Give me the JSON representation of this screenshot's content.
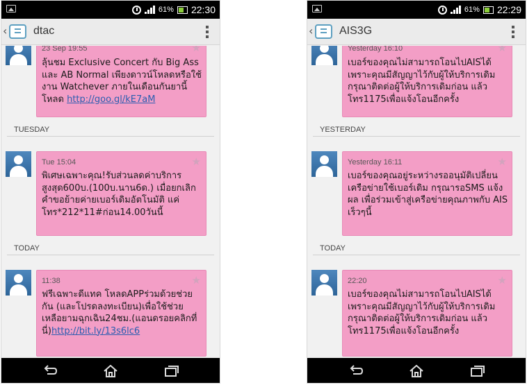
{
  "statusbar": {
    "battery": "61%",
    "left_time": "22:30",
    "right_time": "22:29"
  },
  "left": {
    "title": "dtac",
    "messages": [
      {
        "time": "23 Sep 19:55",
        "text": "ลุ้นชม Exclusive Concert กับ Big Ass และ AB Normal เพียงดาวน์โหลดหรือใช้งาน Watchever ภายในเดือนกันยานี้ โหลด ",
        "link": "http://goo.gl/kE7aM"
      },
      {
        "section": "TUESDAY",
        "time": "Tue 15:04",
        "text": "พิเศษเฉพาะคุณ!รับส่วนลดค่าบริการสูงสุด600บ.(100บ.นาน6ด.) เมื่อยกเลิกคำขอย้ายค่ายเบอร์เดิมอัตโนมัติ แค่โทร*212*11#ก่อน14.00วันนี้",
        "link": ""
      },
      {
        "section": "TODAY",
        "time": "11:38",
        "text": "ฟรีเฉพาะดีแทค โหลดAPPร่วมด้วยช่วยกัน (และโปรดลงทะเบียน)เพื่อใช้ช่วยเหลือยามฉุกเฉิน24ชม.(แอนดรอยคลิกที่นี่)",
        "link": "http://bit.ly/13s6lc6"
      }
    ]
  },
  "right": {
    "title": "AIS3G",
    "messages": [
      {
        "time": "Yesterday 16:10",
        "text": "เบอร์ของคุณไม่สามารถโอนไปAISได้ เพราะคุณมีสัญญาไว้กับผู้ให้บริการเดิม กรุณาติดต่อผู้ให้บริการเดิมก่อน แล้วโทร1175เพื่อแจ้งโอนอีกครั้ง",
        "link": ""
      },
      {
        "section": "YESTERDAY",
        "time": "Yesterday 16:11",
        "text": "เบอร์ของคุณอยู่ระหว่างรออนุมัติเปลี่ยนเครือข่ายใช้เบอร์เดิม กรุณารอSMS แจ้งผล เพื่อร่วมเข้าสู่เครือข่ายคุณภาพกับ AIS เร็วๆนี้",
        "link": ""
      },
      {
        "section": "TODAY",
        "time": "22:20",
        "text": "เบอร์ของคุณไม่สามารถโอนไปAISได้ เพราะคุณมีสัญญาไว้กับผู้ให้บริการเดิม กรุณาติดต่อผู้ให้บริการเดิมก่อน แล้วโทร1175เพื่อแจ้งโอนอีกครั้ง",
        "link": ""
      }
    ]
  }
}
